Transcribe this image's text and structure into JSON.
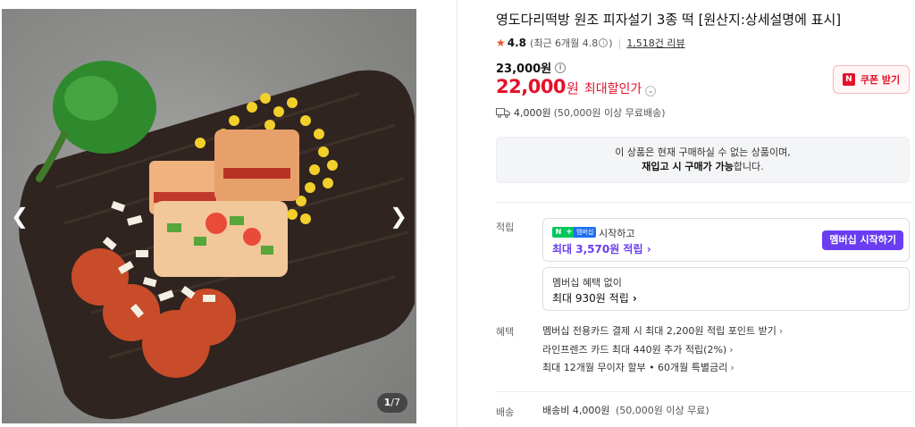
{
  "gallery": {
    "prev_icon": "chevron-left-icon",
    "next_icon": "chevron-right-icon",
    "counter_current": "1",
    "counter_total": "/7"
  },
  "product": {
    "title": "영도다리떡방 원조 피자설기 3종 떡 [원산지:상세설명에 표시]",
    "rating": "4.8",
    "rating_detail_prefix": "(최근 6개월 4.8",
    "rating_detail_suffix": ")",
    "review_link": "1,518건 리뷰",
    "original_price": "23,000원",
    "sale_price": "22,000",
    "sale_unit": "원",
    "sale_label": "최대할인가",
    "coupon_label": "쿠폰 받기",
    "coupon_icon_text": "N",
    "shipping_fee": "4,000원",
    "shipping_note": "(50,000원 이상 무료배송)"
  },
  "notice": {
    "line1": "이 상품은 현재 구매하실 수 없는 상품이며,",
    "line2_bold": "재입고 시 구매가 가능",
    "line2_rest": "합니다."
  },
  "points": {
    "label": "적립",
    "card1": {
      "badge_n": "N",
      "badge_plus": "+",
      "badge_m": "멤버십",
      "top_text": "시작하고",
      "main": "최대 3,570원 적립",
      "button": "멤버십 시작하기"
    },
    "card2": {
      "top_text": "멤버십 혜택 없이",
      "main": "최대 930원 적립"
    }
  },
  "benefits": {
    "label": "혜택",
    "items": [
      "멤버십 전용카드 결제 시 최대 2,200원 적립 포인트 받기",
      "라인프렌즈 카드 최대 440원 추가 적립(2%)",
      "최대 12개월 무이자 할부 • 60개월 특별금리"
    ]
  },
  "delivery": {
    "label": "배송",
    "fee": "배송비 4,000원",
    "note": "(50,000원 이상 무료)"
  },
  "colors": {
    "sale_red": "#e3122b",
    "membership_purple": "#6a3df0",
    "naver_green": "#03c75a"
  }
}
